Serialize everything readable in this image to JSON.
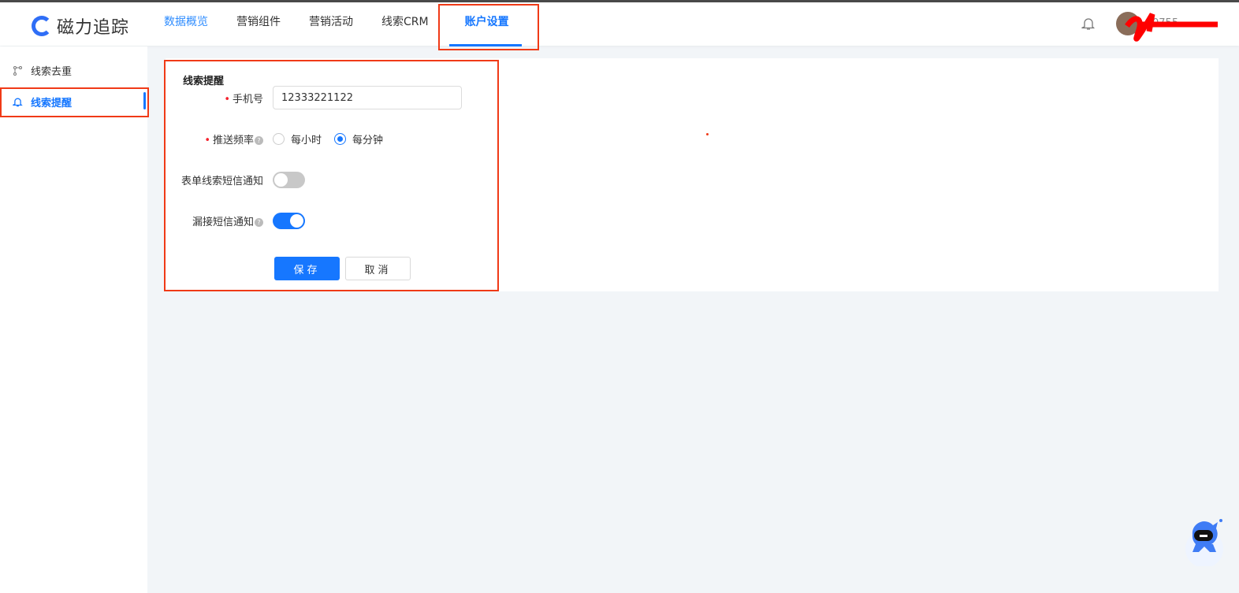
{
  "header": {
    "logo_text": "磁力追踪",
    "nav": [
      {
        "label": "数据概览"
      },
      {
        "label": "营销组件"
      },
      {
        "label": "营销活动"
      },
      {
        "label": "线索CRM"
      },
      {
        "label": "账户设置"
      }
    ],
    "username": "0755"
  },
  "sidebar": {
    "items": [
      {
        "label": "线索去重",
        "icon": "branch-icon"
      },
      {
        "label": "线索提醒",
        "icon": "bell-icon"
      }
    ]
  },
  "form": {
    "title": "线索提醒",
    "phone_label": "手机号",
    "phone_value": "12333221122",
    "frequency_label": "推送频率",
    "frequency_options": [
      {
        "label": "每小时",
        "selected": false
      },
      {
        "label": "每分钟",
        "selected": true
      }
    ],
    "form_sms_label": "表单线索短信通知",
    "form_sms_on": false,
    "missed_sms_label": "漏接短信通知",
    "missed_sms_on": true,
    "help_glyph": "?",
    "save_label": "保存",
    "cancel_label": "取消"
  },
  "colors": {
    "accent": "#1677ff",
    "highlight": "#f03a17"
  }
}
